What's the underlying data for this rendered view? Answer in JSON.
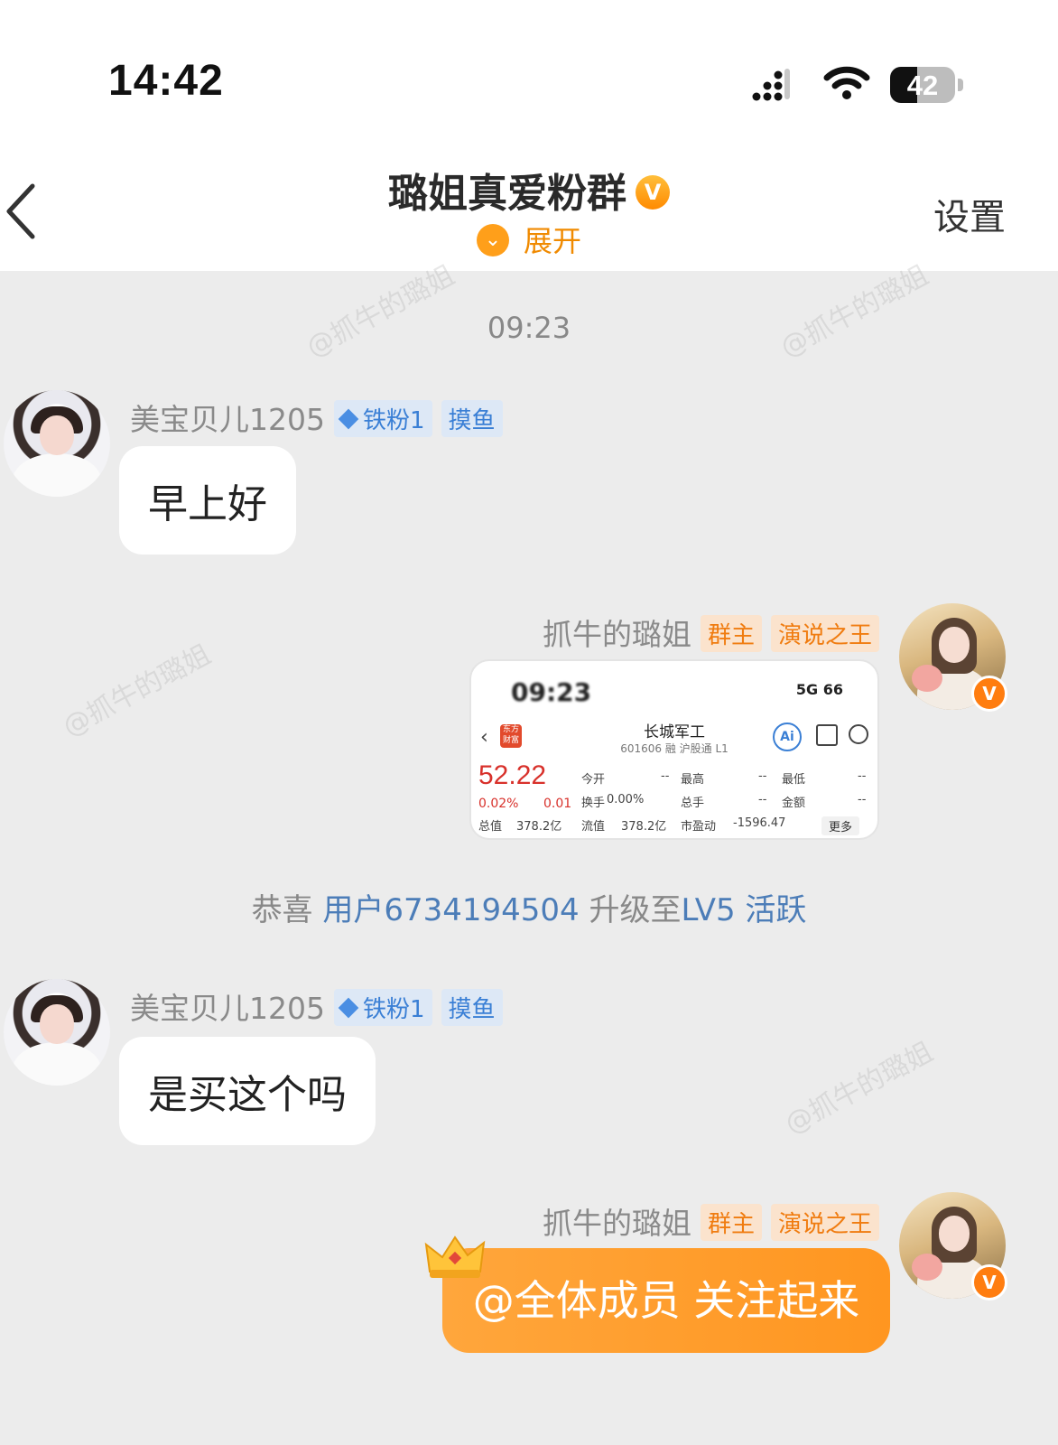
{
  "status_bar": {
    "time": "14:42",
    "battery": "42",
    "battery_fraction": 0.42
  },
  "header": {
    "title": "璐姐真爱粉群",
    "title_badge": "V",
    "expand_label": "展开",
    "expand_icon": "chevron-down-icon",
    "settings_label": "设置"
  },
  "chat": {
    "timestamp": "09:23",
    "watermark_text": "@抓牛的璐姐",
    "messages": [
      {
        "sender": "美宝贝儿1205",
        "tags": [
          "铁粉1",
          "摸鱼"
        ],
        "text": "早上好"
      },
      {
        "sender": "抓牛的璐姐",
        "tags": [
          "群主",
          "演说之王"
        ],
        "image": {
          "status_time": "09:23",
          "status_net": "5G",
          "status_battery": "66",
          "stock_name": "长城军工",
          "stock_code": "601606 融 沪股通 L1",
          "broker_logo": "东方财富",
          "price": "52.22",
          "change_pct": "0.02%",
          "change_abs": "0.01",
          "row1": [
            "今开",
            "--",
            "最高",
            "--",
            "最低",
            "--"
          ],
          "row2": [
            "换手",
            "0.00%",
            "总手",
            "--",
            "金额",
            "--"
          ],
          "row3": [
            "总值",
            "378.2亿",
            "流值",
            "378.2亿",
            "市盈动",
            "-1596.47"
          ],
          "more": "更多",
          "ai": "Ai"
        }
      },
      {
        "system": {
          "prefix": "恭喜",
          "user": "用户6734194504",
          "middle": "升级至",
          "level": "LV5 活跃"
        }
      },
      {
        "sender": "美宝贝儿1205",
        "tags": [
          "铁粉1",
          "摸鱼"
        ],
        "text": "是买这个吗"
      },
      {
        "sender": "抓牛的璐姐",
        "tags": [
          "群主",
          "演说之王"
        ],
        "text": "@全体成员 关注起来"
      }
    ]
  }
}
